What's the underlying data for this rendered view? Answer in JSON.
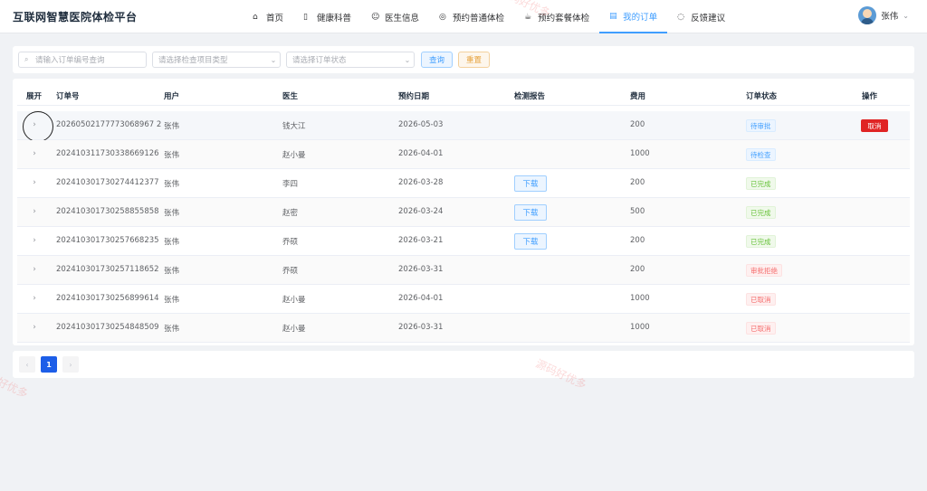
{
  "app": {
    "title": "互联网智慧医院体检平台"
  },
  "nav": [
    {
      "label": "首页",
      "icon": "home-icon",
      "active": false
    },
    {
      "label": "健康科普",
      "icon": "book-icon",
      "active": false
    },
    {
      "label": "医生信息",
      "icon": "user-icon",
      "active": false
    },
    {
      "label": "预约普通体检",
      "icon": "check-circle-icon",
      "active": false
    },
    {
      "label": "预约套餐体检",
      "icon": "cup-icon",
      "active": false
    },
    {
      "label": "我的订单",
      "icon": "document-icon",
      "active": true
    },
    {
      "label": "反馈建议",
      "icon": "chat-icon",
      "active": false
    }
  ],
  "user": {
    "name": "张伟"
  },
  "filters": {
    "order_placeholder": "请输入订单编号查询",
    "type_placeholder": "请选择检查项目类型",
    "status_placeholder": "请选择订单状态",
    "query_label": "查询",
    "reset_label": "重置"
  },
  "table": {
    "headers": [
      "展开",
      "订单号",
      "用户",
      "医生",
      "预约日期",
      "检测报告",
      "费用",
      "订单状态",
      "操作"
    ],
    "download_label": "下载",
    "cancel_label": "取消",
    "rows": [
      {
        "order": "20260502177773068967 2",
        "user": "张伟",
        "doctor": "钱大江",
        "date": "2026-05-03",
        "report": false,
        "fee": "200",
        "status": "待审批",
        "status_type": "info",
        "action": true
      },
      {
        "order": "202410311730338669126",
        "user": "张伟",
        "doctor": "赵小曼",
        "date": "2026-04-01",
        "report": false,
        "fee": "1000",
        "status": "待检查",
        "status_type": "info",
        "action": false
      },
      {
        "order": "202410301730274412377",
        "user": "张伟",
        "doctor": "李四",
        "date": "2026-03-28",
        "report": true,
        "fee": "200",
        "status": "已完成",
        "status_type": "success",
        "action": false
      },
      {
        "order": "202410301730258855858",
        "user": "张伟",
        "doctor": "赵密",
        "date": "2026-03-24",
        "report": true,
        "fee": "500",
        "status": "已完成",
        "status_type": "success",
        "action": false
      },
      {
        "order": "202410301730257668235",
        "user": "张伟",
        "doctor": "乔硕",
        "date": "2026-03-21",
        "report": true,
        "fee": "200",
        "status": "已完成",
        "status_type": "success",
        "action": false
      },
      {
        "order": "202410301730257118652",
        "user": "张伟",
        "doctor": "乔硕",
        "date": "2026-03-31",
        "report": false,
        "fee": "200",
        "status": "审批拒绝",
        "status_type": "danger",
        "action": false
      },
      {
        "order": "202410301730256899614",
        "user": "张伟",
        "doctor": "赵小曼",
        "date": "2026-04-01",
        "report": false,
        "fee": "1000",
        "status": "已取消",
        "status_type": "danger",
        "action": false
      },
      {
        "order": "202410301730254848509",
        "user": "张伟",
        "doctor": "赵小曼",
        "date": "2026-03-31",
        "report": false,
        "fee": "1000",
        "status": "已取消",
        "status_type": "danger",
        "action": false
      }
    ]
  },
  "pagination": {
    "current": "1",
    "prev": "‹",
    "next": "›"
  },
  "watermarks": [
    "源码好优多",
    "好优多",
    "源码好优多"
  ],
  "colors": {
    "accent": "#409eff",
    "danger_button": "#e02424",
    "page_current": "#1d5ee8"
  }
}
